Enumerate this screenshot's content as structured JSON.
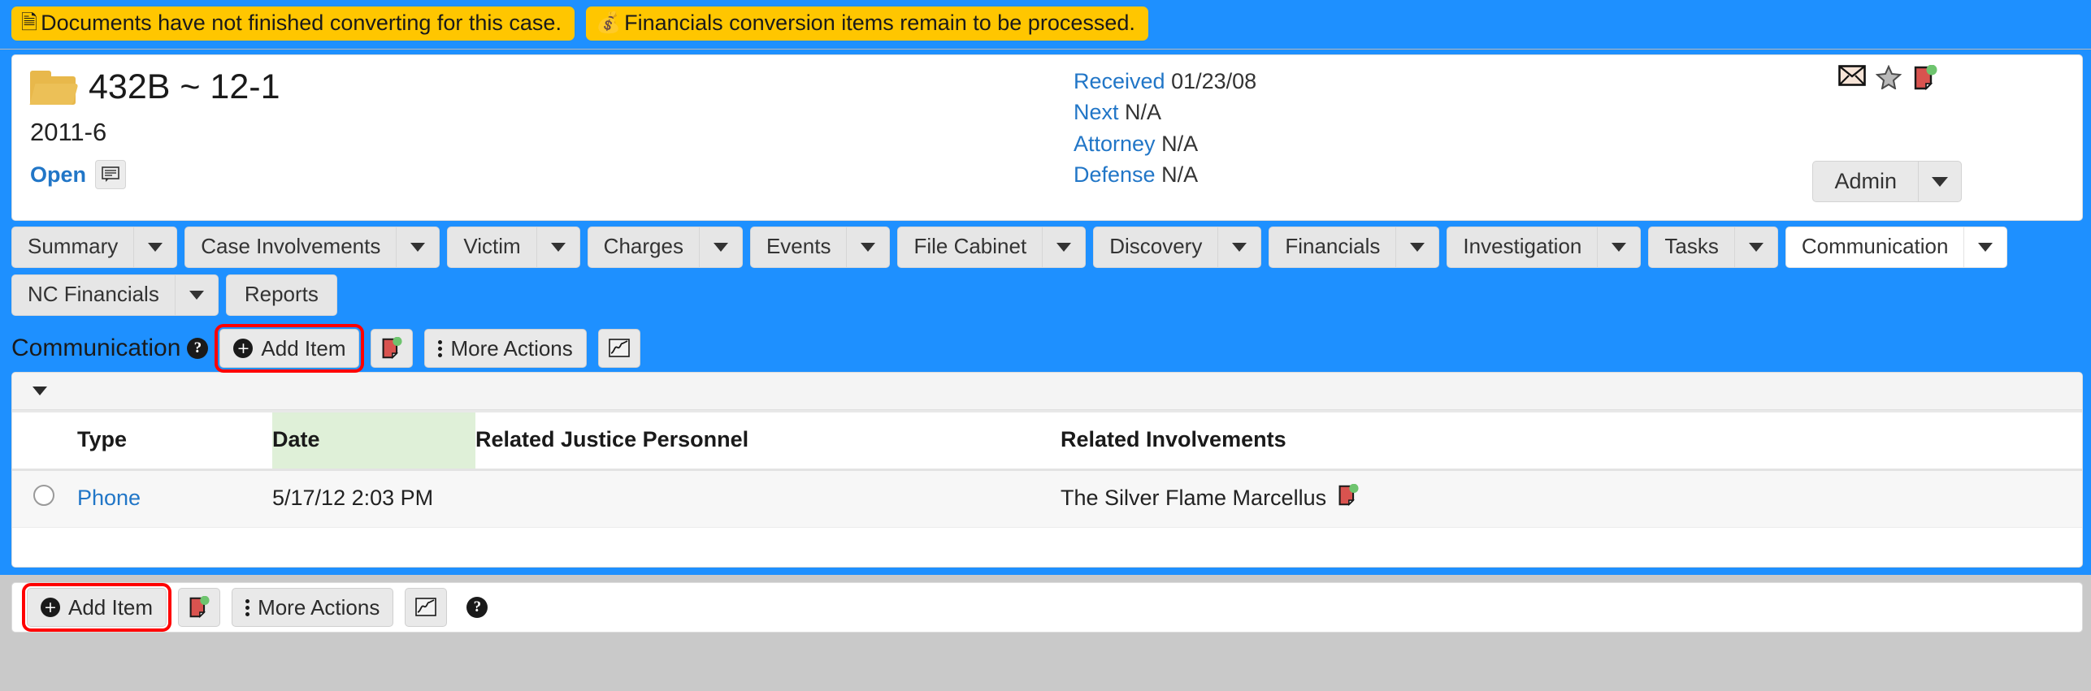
{
  "alerts": [
    {
      "icon": "document-icon",
      "glyph": "🗎",
      "text": "Documents have not finished converting for this case."
    },
    {
      "icon": "money-bag-clock-icon",
      "glyph": "💰",
      "text": "Financials conversion items remain to be processed."
    }
  ],
  "case": {
    "folder_icon": "folder-icon",
    "title": "432B ~ 12-1",
    "subtitle": "2011-6",
    "status": "Open",
    "note_icon": "note-icon",
    "meta": [
      {
        "label": "Received",
        "value": "01/23/08"
      },
      {
        "label": "Next",
        "value": "N/A"
      },
      {
        "label": "Attorney",
        "value": "N/A"
      },
      {
        "label": "Defense",
        "value": "N/A"
      }
    ],
    "icons": [
      {
        "name": "envelope-icon"
      },
      {
        "name": "star-icon"
      },
      {
        "name": "red-document-icon"
      }
    ],
    "admin_label": "Admin"
  },
  "tabs_row1": [
    {
      "label": "Summary",
      "caret": true,
      "active": false
    },
    {
      "label": "Case Involvements",
      "caret": true,
      "active": false
    },
    {
      "label": "Victim",
      "caret": true,
      "active": false
    },
    {
      "label": "Charges",
      "caret": true,
      "active": false
    },
    {
      "label": "Events",
      "caret": true,
      "active": false
    },
    {
      "label": "File Cabinet",
      "caret": true,
      "active": false
    },
    {
      "label": "Discovery",
      "caret": true,
      "active": false
    },
    {
      "label": "Financials",
      "caret": true,
      "active": false
    },
    {
      "label": "Investigation",
      "caret": true,
      "active": false
    },
    {
      "label": "Tasks",
      "caret": true,
      "active": false
    },
    {
      "label": "Communication",
      "caret": true,
      "active": true
    }
  ],
  "tabs_row2": [
    {
      "label": "NC Financials",
      "caret": true,
      "active": false
    },
    {
      "label": "Reports",
      "caret": false,
      "active": false
    }
  ],
  "section": {
    "title": "Communication",
    "help_glyph": "?",
    "add_item_label": "Add Item",
    "more_actions_label": "More Actions",
    "doc_icon": "red-document-icon",
    "chart_icon": "chart-icon",
    "highlight_color": "#ff0000"
  },
  "table": {
    "columns": [
      {
        "label": "",
        "key": "select"
      },
      {
        "label": "Type",
        "key": "type"
      },
      {
        "label": "Date",
        "key": "date",
        "sorted": true
      },
      {
        "label": "Related Justice Personnel",
        "key": "rjp"
      },
      {
        "label": "Related Involvements",
        "key": "ri"
      }
    ],
    "rows": [
      {
        "type": "Phone",
        "date": "5/17/12 2:03 PM",
        "rjp": "",
        "ri": "The Silver Flame Marcellus",
        "ri_icon": "red-document-icon"
      }
    ]
  },
  "footer": {
    "add_item_label": "Add Item",
    "more_actions_label": "More Actions",
    "doc_icon": "red-document-icon",
    "chart_icon": "chart-icon",
    "help_glyph": "?"
  },
  "colors": {
    "page_blue": "#1e90ff",
    "alert_yellow": "#ffc600",
    "link_blue": "#2176c7",
    "sorted_green": "#dff0d8",
    "highlight_red": "#ff0000"
  }
}
